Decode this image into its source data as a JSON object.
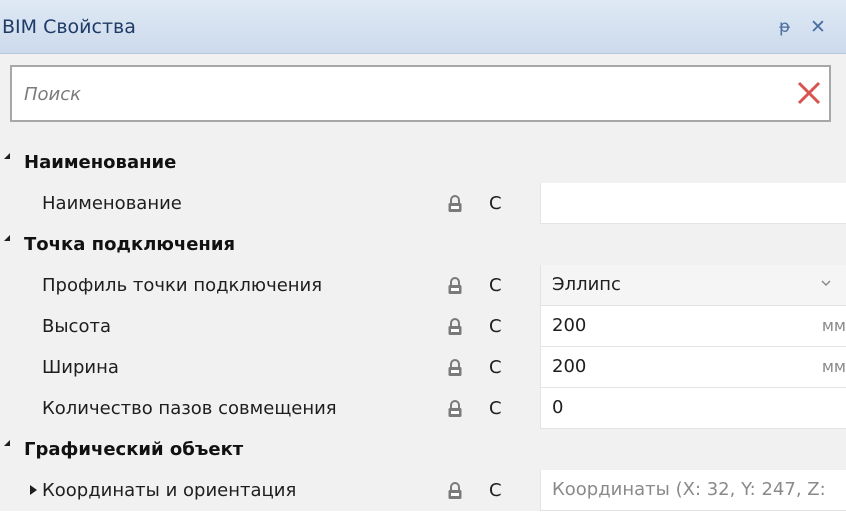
{
  "panel": {
    "title": "BIM Свойства",
    "pin_glyph": "ᵽ",
    "close_glyph": "✕"
  },
  "search": {
    "placeholder": "Поиск",
    "value": ""
  },
  "categories": [
    {
      "label": "Наименование",
      "properties": [
        {
          "label": "Наименование",
          "flag": "С",
          "value": ""
        }
      ]
    },
    {
      "label": "Точка подключения",
      "properties": [
        {
          "label": "Профиль точки подключения",
          "flag": "С",
          "value": "Эллипс",
          "type": "dropdown"
        },
        {
          "label": "Высота",
          "flag": "С",
          "value": "200",
          "unit": "мм"
        },
        {
          "label": "Ширина",
          "flag": "С",
          "value": "200",
          "unit": "мм"
        },
        {
          "label": "Количество пазов совмещения",
          "flag": "С",
          "value": "0"
        }
      ]
    },
    {
      "label": "Графический объект",
      "properties": [
        {
          "label": "Координаты и ориентация",
          "flag": "С",
          "value": "Координаты (X: 32, Y: 247, Z:",
          "expandable": true
        }
      ]
    }
  ],
  "colors": {
    "title_gradient_top": "#dfe9f5",
    "title_gradient_bottom": "#ccdaeb",
    "clear_icon": "#d9534f",
    "lock_icon": "#7a7a7a"
  }
}
